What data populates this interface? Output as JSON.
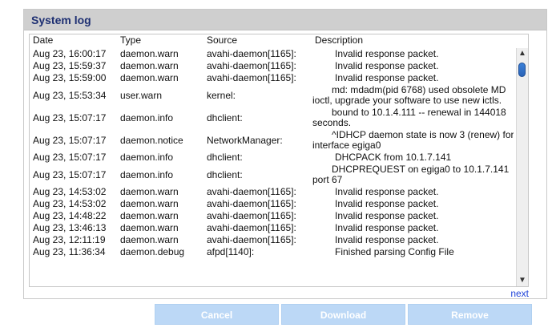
{
  "panel": {
    "title": "System log"
  },
  "log": {
    "columns": {
      "date": "Date",
      "type": "Type",
      "source": "Source",
      "description": "Description"
    },
    "rows": [
      {
        "date": "Aug 23, 16:00:17",
        "type": "daemon.warn",
        "source": "avahi-daemon[1165]:",
        "description": "Invalid response packet.",
        "tall": false
      },
      {
        "date": "Aug 23, 15:59:37",
        "type": "daemon.warn",
        "source": "avahi-daemon[1165]:",
        "description": "Invalid response packet.",
        "tall": false
      },
      {
        "date": "Aug 23, 15:59:00",
        "type": "daemon.warn",
        "source": "avahi-daemon[1165]:",
        "description": "Invalid response packet.",
        "tall": false
      },
      {
        "date": "Aug 23, 15:53:34",
        "type": "user.warn",
        "source": "kernel:",
        "description": "md: mdadm(pid 6768) used obsolete MD ioctl, upgrade your software to use new ictls.",
        "tall": true
      },
      {
        "date": "Aug 23, 15:07:17",
        "type": "daemon.info",
        "source": "dhclient:",
        "description": "bound to 10.1.4.111 -- renewal in 144018 seconds.",
        "tall": true
      },
      {
        "date": "Aug 23, 15:07:17",
        "type": "daemon.notice",
        "source": "NetworkManager:",
        "description": "^IDHCP daemon state is now 3 (renew) for interface egiga0",
        "tall": true
      },
      {
        "date": "Aug 23, 15:07:17",
        "type": "daemon.info",
        "source": "dhclient:",
        "description": "DHCPACK from 10.1.7.141",
        "tall": false
      },
      {
        "date": "Aug 23, 15:07:17",
        "type": "daemon.info",
        "source": "dhclient:",
        "description": "DHCPREQUEST on egiga0 to 10.1.7.141 port 67",
        "tall": true
      },
      {
        "date": "Aug 23, 14:53:02",
        "type": "daemon.warn",
        "source": "avahi-daemon[1165]:",
        "description": "Invalid response packet.",
        "tall": false
      },
      {
        "date": "Aug 23, 14:53:02",
        "type": "daemon.warn",
        "source": "avahi-daemon[1165]:",
        "description": "Invalid response packet.",
        "tall": false
      },
      {
        "date": "Aug 23, 14:48:22",
        "type": "daemon.warn",
        "source": "avahi-daemon[1165]:",
        "description": "Invalid response packet.",
        "tall": false
      },
      {
        "date": "Aug 23, 13:46:13",
        "type": "daemon.warn",
        "source": "avahi-daemon[1165]:",
        "description": "Invalid response packet.",
        "tall": false
      },
      {
        "date": "Aug 23, 12:11:19",
        "type": "daemon.warn",
        "source": "avahi-daemon[1165]:",
        "description": "Invalid response packet.",
        "tall": false
      },
      {
        "date": "Aug 23, 11:36:34",
        "type": "daemon.debug",
        "source": "afpd[1140]:",
        "description": "Finished parsing Config File",
        "tall": false
      }
    ]
  },
  "pagination": {
    "next_label": "next"
  },
  "buttons": {
    "cancel": "Cancel",
    "download": "Download",
    "remove": "Remove"
  },
  "icons": {
    "scroll_up": "scroll-up-arrow-icon",
    "scroll_down": "scroll-down-arrow-icon"
  },
  "colors": {
    "title": "#1d2f72",
    "header_bg": "#cfcfcf",
    "button_bg": "#bcd8f6",
    "link": "#1f43d8",
    "scroll_thumb": "#2f6fcb"
  }
}
